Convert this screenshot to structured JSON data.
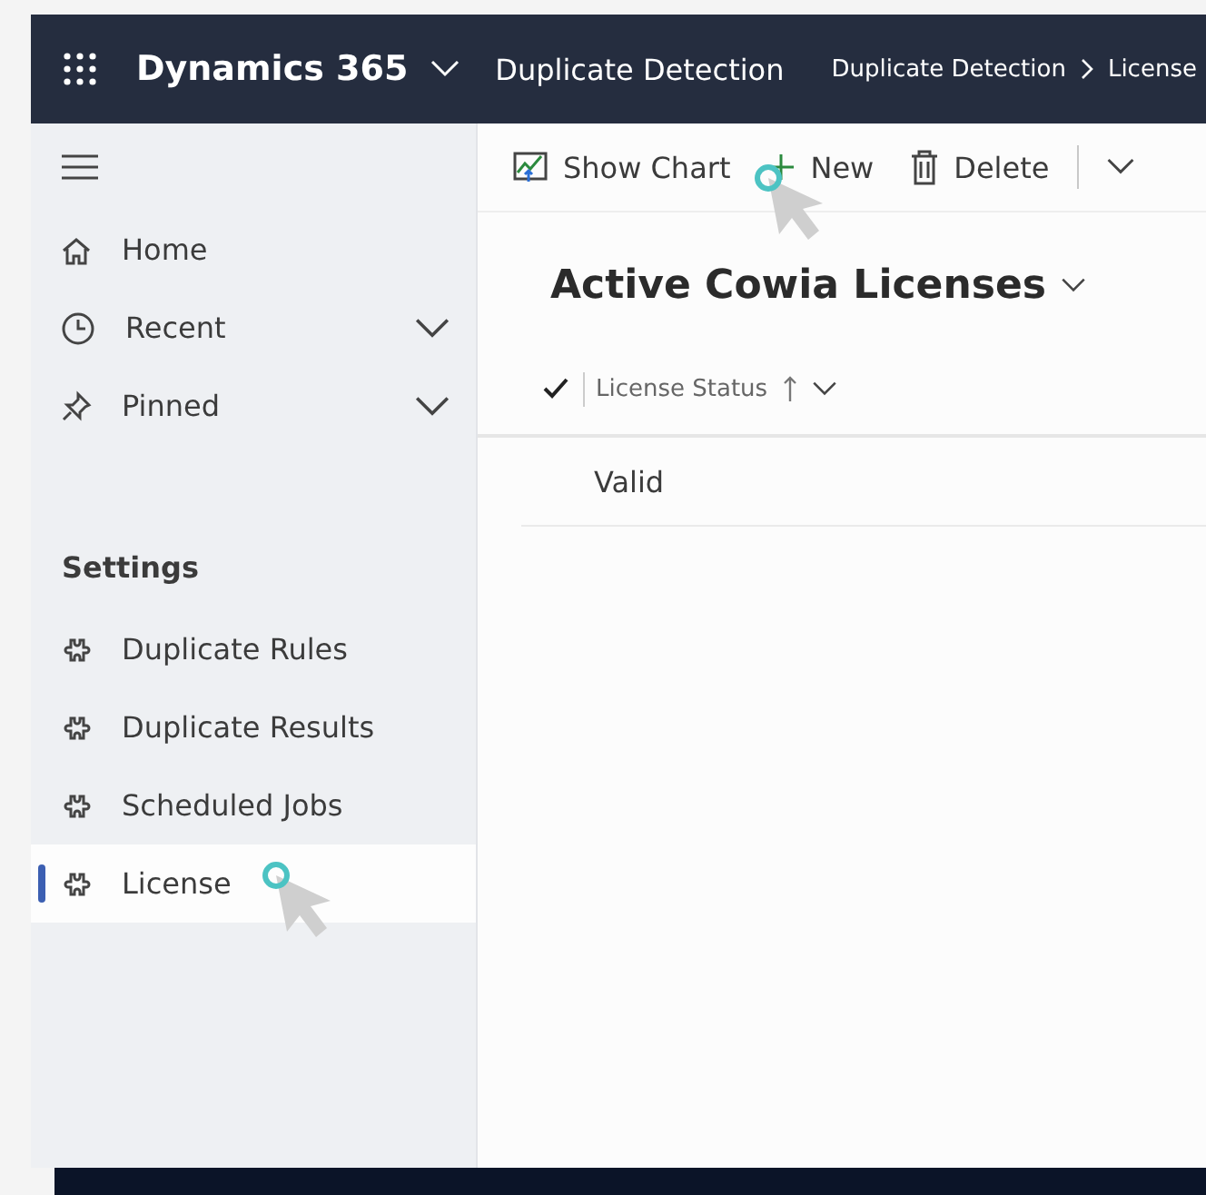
{
  "header": {
    "app_name": "Dynamics 365",
    "area": "Duplicate Detection",
    "breadcrumb": [
      "Duplicate Detection",
      "License"
    ]
  },
  "sidebar": {
    "nav": [
      {
        "label": "Home",
        "kind": "link"
      },
      {
        "label": "Recent",
        "kind": "group",
        "expanded": false
      },
      {
        "label": "Pinned",
        "kind": "group",
        "expanded": false
      }
    ],
    "section_title": "Settings",
    "items": [
      {
        "label": "Duplicate Rules",
        "selected": false
      },
      {
        "label": "Duplicate Results",
        "selected": false
      },
      {
        "label": "Scheduled Jobs",
        "selected": false
      },
      {
        "label": "License",
        "selected": true
      }
    ]
  },
  "toolbar": [
    {
      "label": "Show Chart",
      "kind": "chart"
    },
    {
      "label": "New",
      "kind": "new"
    },
    {
      "label": "Delete",
      "kind": "delete"
    }
  ],
  "view": {
    "title": "Active Cowia Licenses",
    "columns": [
      {
        "label": "License Status",
        "sorted_ascending": true
      }
    ],
    "rows": [
      [
        "Valid"
      ]
    ]
  }
}
